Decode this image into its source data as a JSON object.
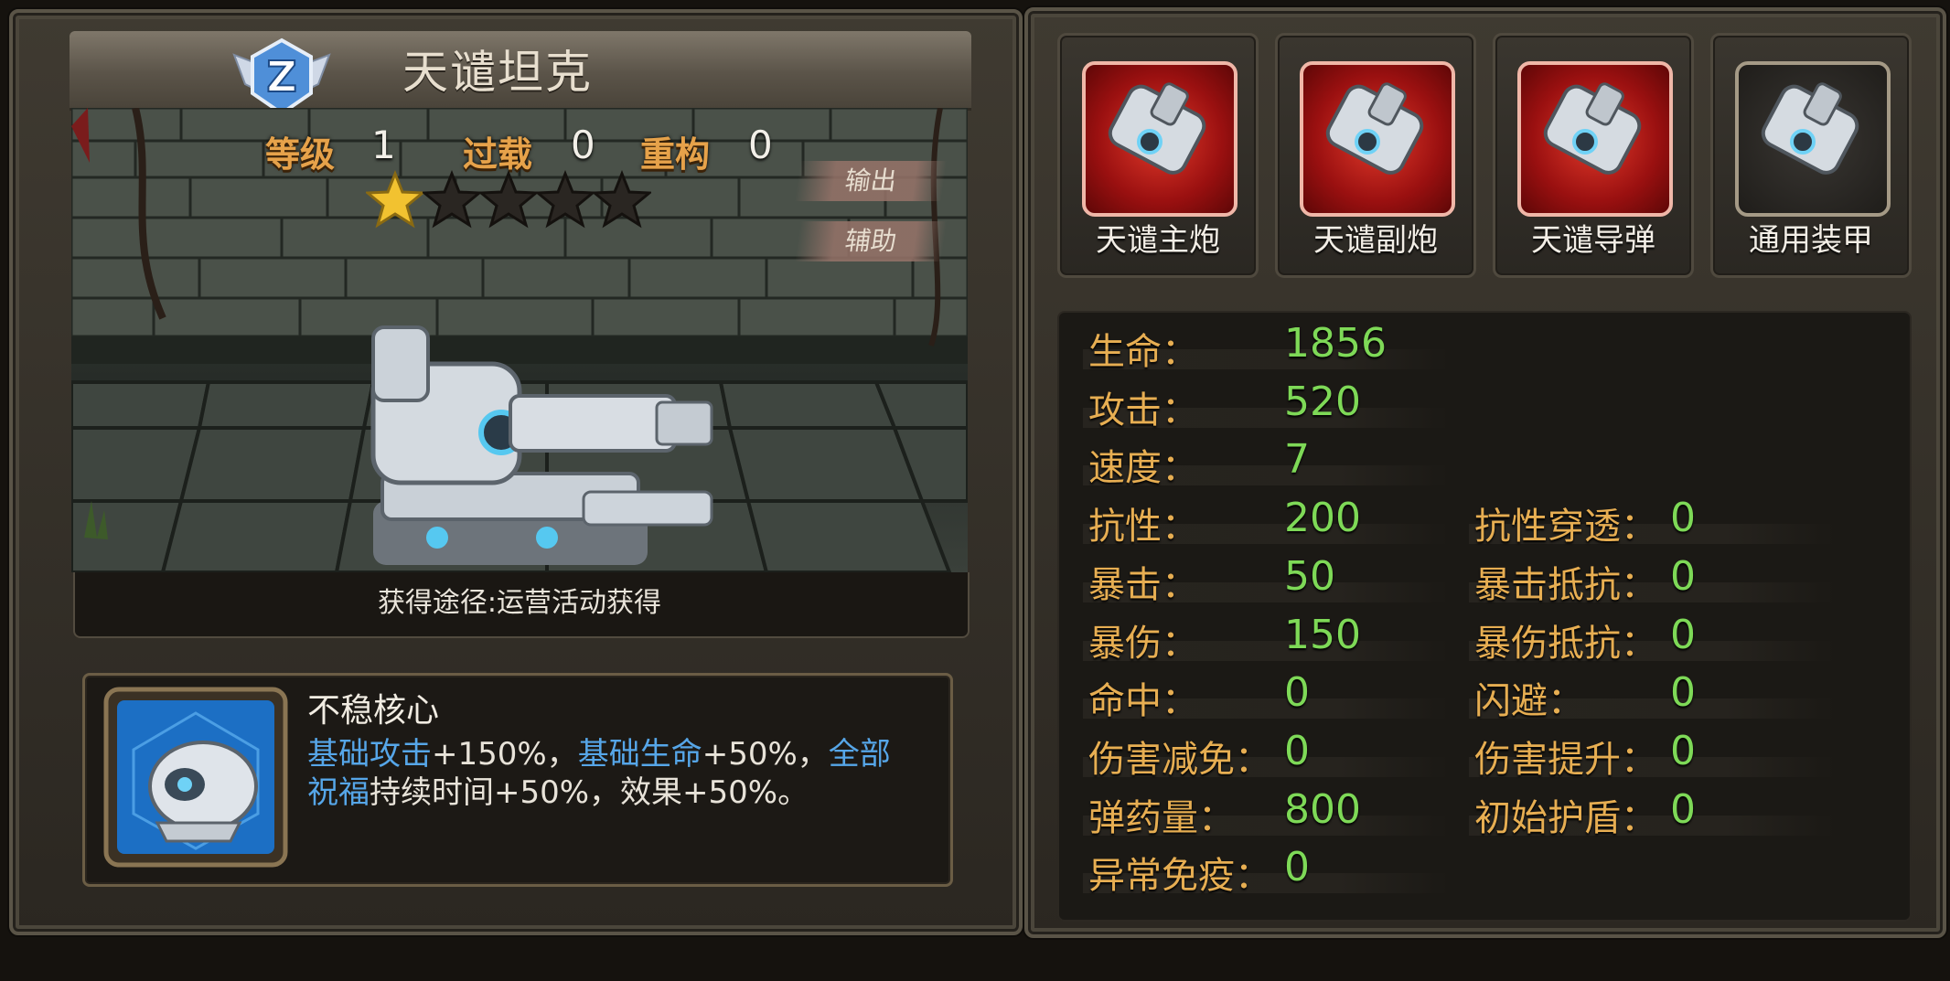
{
  "tank": {
    "name": "天谴坦克",
    "rank_letter": "Z",
    "level_label": "等级",
    "level_value": "1",
    "overload_label": "过载",
    "overload_value": "0",
    "rebuild_label": "重构",
    "rebuild_value": "0",
    "stars_filled": 1,
    "stars_total": 5,
    "role_tags": [
      "输出",
      "辅助"
    ],
    "source": "获得途径:运营活动获得"
  },
  "skill": {
    "name": "不稳核心",
    "desc_parts": [
      {
        "text": "基础攻击",
        "highlight": true
      },
      {
        "text": "+150%，",
        "highlight": false
      },
      {
        "text": "基础生命",
        "highlight": true
      },
      {
        "text": "+50%，",
        "highlight": false
      },
      {
        "text": "全部祝福",
        "highlight": true
      },
      {
        "text": "持续时间+50%，效果+50%。",
        "highlight": false
      }
    ]
  },
  "equipment": [
    {
      "label": "天谴主炮",
      "icon": "main-cannon-icon",
      "frame": "red"
    },
    {
      "label": "天谴副炮",
      "icon": "secondary-cannon-icon",
      "frame": "red"
    },
    {
      "label": "天谴导弹",
      "icon": "missile-icon",
      "frame": "red"
    },
    {
      "label": "通用装甲",
      "icon": "armor-icon",
      "frame": "gray"
    }
  ],
  "attributes_left": [
    {
      "label": "生命：",
      "value": "1856"
    },
    {
      "label": "攻击：",
      "value": "520"
    },
    {
      "label": "速度：",
      "value": "7"
    },
    {
      "label": "抗性：",
      "value": "200"
    },
    {
      "label": "暴击：",
      "value": "50"
    },
    {
      "label": "暴伤：",
      "value": "150"
    },
    {
      "label": "命中：",
      "value": "0"
    },
    {
      "label": "伤害减免：",
      "value": "0"
    },
    {
      "label": "弹药量：",
      "value": "800"
    },
    {
      "label": "异常免疫：",
      "value": "0"
    }
  ],
  "attributes_right": [
    {
      "label": "抗性穿透：",
      "value": "0"
    },
    {
      "label": "暴击抵抗：",
      "value": "0"
    },
    {
      "label": "暴伤抵抗：",
      "value": "0"
    },
    {
      "label": "闪避：",
      "value": "0"
    },
    {
      "label": "伤害提升：",
      "value": "0"
    },
    {
      "label": "初始护盾：",
      "value": "0"
    }
  ],
  "colors": {
    "stat_label": "#e6a24a",
    "attr_label": "#e7ae52",
    "attr_value": "#7ed957",
    "highlight": "#56a6e8",
    "star_filled": "#f2c230"
  }
}
